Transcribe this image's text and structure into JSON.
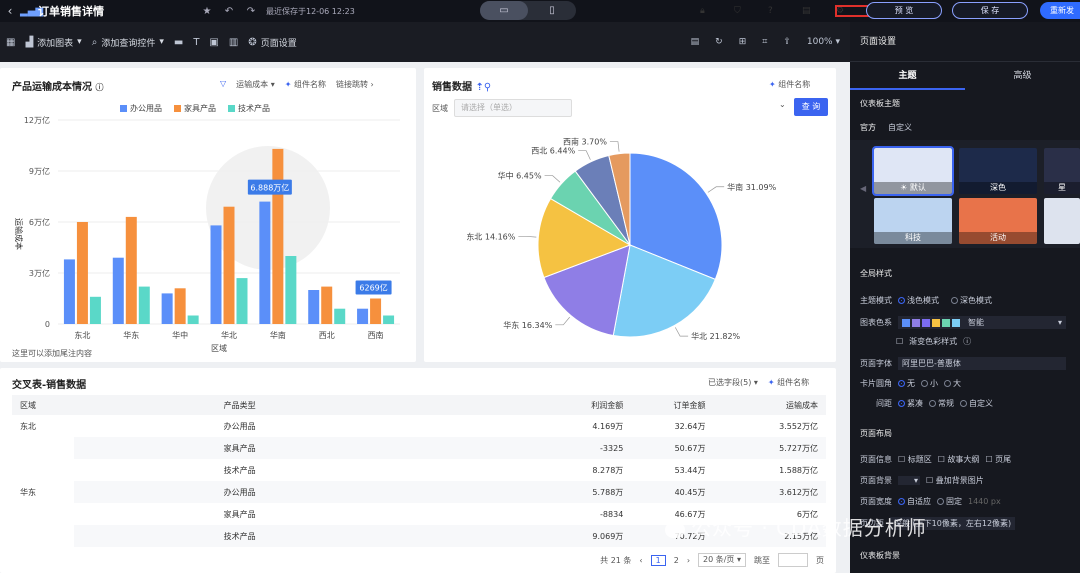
{
  "header": {
    "title": "订单销售详情",
    "last_saved": "最近保存于12-06 12:23",
    "preview": "预 览",
    "save": "保 存",
    "publish": "重新发"
  },
  "toolbar": {
    "add_chart": "添加图表",
    "add_query": "添加查询控件",
    "page_settings": "页面设置",
    "zoom": "100%"
  },
  "bar_card": {
    "title": "产品运输成本情况",
    "filter_link": "运输成本",
    "component_name": "组件名称",
    "link_jump": "链接跳转",
    "footnote": "这里可以添加尾注内容",
    "tooltip_value": "6.888万亿",
    "tooltip_value2": "6269亿"
  },
  "pie_card": {
    "title": "销售数据",
    "component_name": "组件名称",
    "region_label": "区域",
    "region_placeholder": "请选择（单选）",
    "query": "查 询"
  },
  "chart_data": [
    {
      "type": "bar",
      "title": "产品运输成本情况",
      "categories": [
        "东北",
        "华东",
        "华中",
        "华北",
        "华南",
        "西北",
        "西南"
      ],
      "series": [
        {
          "name": "办公用品",
          "values": [
            3.8,
            3.9,
            1.8,
            5.8,
            7.2,
            2.0,
            0.9
          ]
        },
        {
          "name": "家具产品",
          "values": [
            6.0,
            6.3,
            2.1,
            6.9,
            10.3,
            2.2,
            1.5
          ]
        },
        {
          "name": "技术产品",
          "values": [
            1.6,
            2.2,
            0.5,
            2.7,
            4.0,
            0.9,
            0.5
          ]
        }
      ],
      "xlabel": "区域",
      "ylabel": "运输成本",
      "yticks": [
        "0",
        "3万亿",
        "6万亿",
        "9万亿",
        "12万亿"
      ],
      "ylim": [
        0,
        12
      ],
      "colors": [
        "#5b8ff9",
        "#f6903d",
        "#5ad8c8"
      ],
      "legend": "top"
    },
    {
      "type": "pie",
      "title": "销售数据",
      "labels": [
        "华南",
        "华北",
        "华东",
        "东北",
        "华中",
        "西北",
        "西南"
      ],
      "values": [
        31.09,
        21.82,
        16.34,
        14.16,
        6.45,
        6.44,
        3.7
      ],
      "label_texts": [
        "华南 31.09%",
        "华北 21.82%",
        "华东 16.34%",
        "东北 14.16%",
        "华中 6.45%",
        "西北 6.44%",
        "西南 3.70%"
      ],
      "colors": [
        "#5b8ff9",
        "#7ccdf5",
        "#8f7ee6",
        "#f5c242",
        "#6bd3b0",
        "#6b7fb8",
        "#e59a5f"
      ]
    }
  ],
  "table": {
    "title": "交叉表-销售数据",
    "selected_fields": "已选字段(5)",
    "component_name": "组件名称",
    "headers": [
      "区域",
      "产品类型",
      "利润金额",
      "订单金额",
      "运输成本"
    ],
    "rows": [
      [
        "东北",
        "办公用品",
        "4.169万",
        "32.64万",
        "3.552万亿"
      ],
      [
        "",
        "家具产品",
        "-3325",
        "50.67万",
        "5.727万亿"
      ],
      [
        "",
        "技术产品",
        "8.278万",
        "53.44万",
        "1.588万亿"
      ],
      [
        "华东",
        "办公用品",
        "5.788万",
        "40.45万",
        "3.612万亿"
      ],
      [
        "",
        "家具产品",
        "-8834",
        "46.67万",
        "6万亿"
      ],
      [
        "",
        "技术产品",
        "9.069万",
        "70.72万",
        "2.15万亿"
      ]
    ],
    "pager": {
      "total": "共 21 条",
      "p1": "1",
      "p2": "2",
      "per_page": "20 条/页",
      "goto": "跳至",
      "page": "页"
    }
  },
  "right_panel": {
    "header": "页面设置",
    "tab_theme": "主题",
    "tab_advanced": "高级",
    "dashboard_theme": "仪表板主题",
    "official": "官方",
    "custom": "自定义",
    "themes": [
      "默认",
      "深色",
      "星",
      "科技",
      "活动",
      ""
    ],
    "global_style": "全局样式",
    "theme_mode": "主题模式",
    "light_mode": "浅色模式",
    "dark_mode": "深色模式",
    "chart_colors": "图表色系",
    "smart": "智能",
    "gradient": "渐变色彩样式",
    "page_font": "页面字体",
    "font_name": "阿里巴巴-普惠体",
    "card_radius": "卡片圆角",
    "none": "无",
    "small": "小",
    "large": "大",
    "spacing": "间距",
    "compact": "紧凑",
    "normal": "常规",
    "custom2": "自定义",
    "page_layout": "页面布局",
    "page_info": "页面信息",
    "title_area": "标题区",
    "story": "故事大纲",
    "wide": "页尾",
    "page_bg": "页面背景",
    "overlay_bg": "叠加背景图片",
    "page_width": "页面宽度",
    "adaptive": "自适应",
    "fixed": "固定",
    "width_val": "1440",
    "px": "px",
    "margin": "页边距",
    "fold": "深般",
    "margin_desc": "上下10像素，左右12像素)",
    "dashboard_bg": "仪表板背景",
    "watermark": "公众号 · CDA数据分析师"
  },
  "colors": {
    "accent": "#3b64f0",
    "highlight_border": "#e0302b"
  }
}
